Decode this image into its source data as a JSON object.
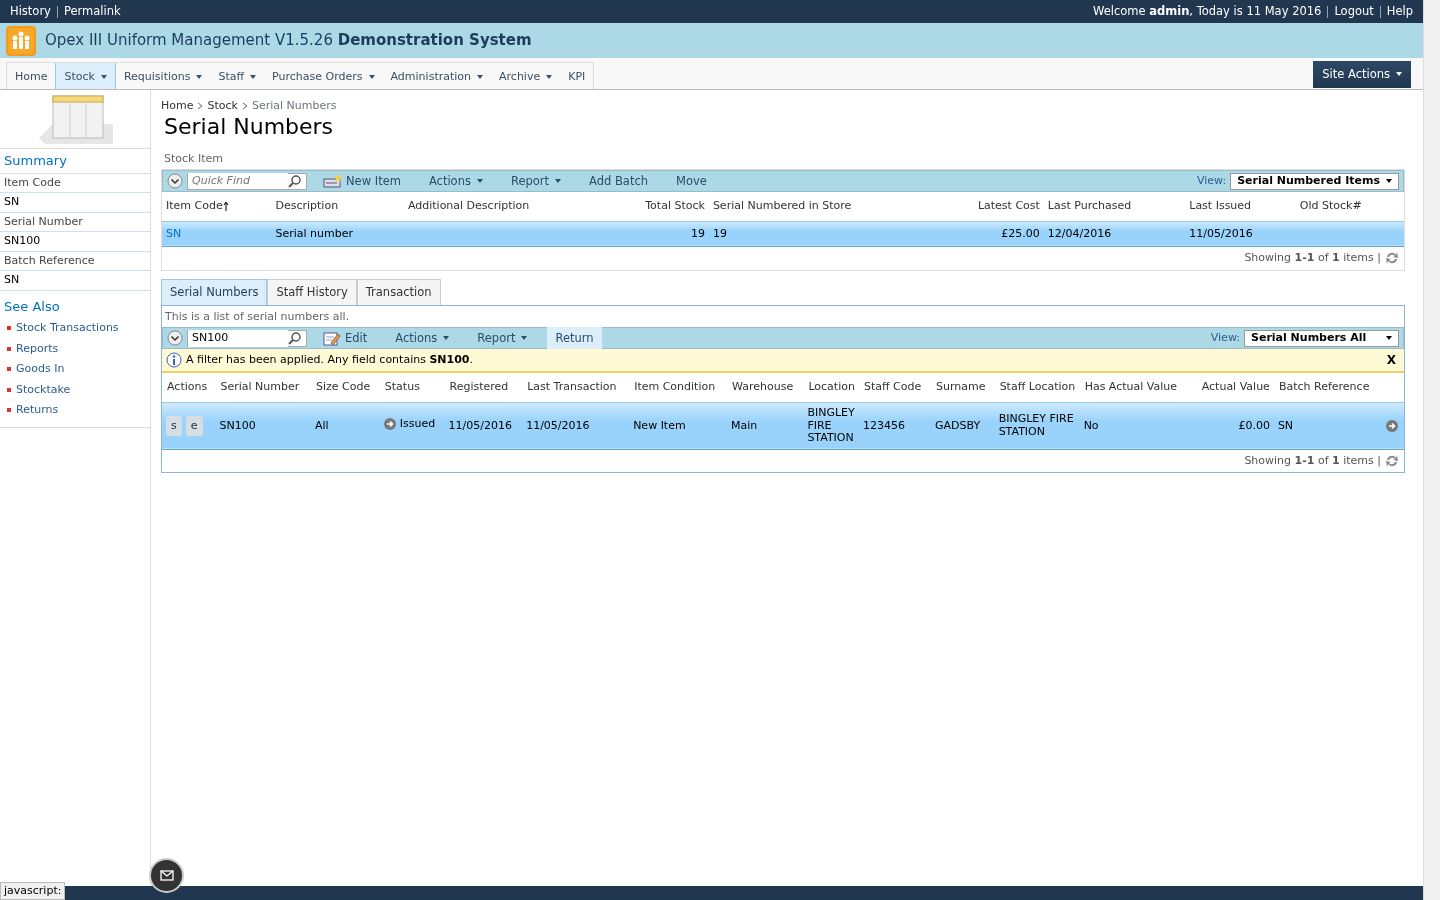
{
  "top_bar": {
    "links": [
      "History",
      "Permalink"
    ],
    "welcome": "Welcome **admin**, Today is 11 May 2016",
    "right_links": [
      "Logout",
      "Help"
    ]
  },
  "header": {
    "title": "Opex III Uniform Management V1.5.26 **Demonstration System**"
  },
  "nav": {
    "items": [
      {
        "label": "Home",
        "has_menu": false,
        "selected": false
      },
      {
        "label": "Stock",
        "has_menu": true,
        "selected": true
      },
      {
        "label": "Requisitions",
        "has_menu": true,
        "selected": false
      },
      {
        "label": "Staff",
        "has_menu": true,
        "selected": false
      },
      {
        "label": "Purchase Orders",
        "has_menu": true,
        "selected": false
      },
      {
        "label": "Administration",
        "has_menu": true,
        "selected": false
      },
      {
        "label": "Archive",
        "has_menu": true,
        "selected": false
      },
      {
        "label": "KPI",
        "has_menu": false,
        "selected": false
      }
    ],
    "site_actions": "Site Actions"
  },
  "sidebar": {
    "summary_title": "Summary",
    "fields": [
      {
        "label": "Item Code",
        "value": "SN"
      },
      {
        "label": "Serial Number",
        "value": "SN100"
      },
      {
        "label": "Batch Reference",
        "value": "SN"
      }
    ],
    "see_also_title": "See Also",
    "links": [
      "Stock Transactions",
      "Reports",
      "Goods In",
      "Stocktake",
      "Returns"
    ]
  },
  "breadcrumb": {
    "links": [
      "Home",
      "Stock"
    ],
    "current": "Serial Numbers"
  },
  "page_title": "Serial Numbers",
  "stock_section": {
    "label": "Stock Item",
    "toolbar": {
      "search_placeholder": "Quick Find",
      "buttons": [
        {
          "label": "New Item",
          "kind": "new"
        },
        {
          "label": "Actions",
          "kind": "menu"
        },
        {
          "label": "Report",
          "kind": "menu"
        },
        {
          "label": "Add Batch",
          "kind": "plain"
        },
        {
          "label": "Move",
          "kind": "plain"
        }
      ],
      "view_label": "View:",
      "view": "Serial Numbered Items"
    },
    "columns": [
      {
        "label": "Item Code",
        "kind": "link",
        "sorted": true
      },
      {
        "label": "Description",
        "kind": "text",
        "sorted": false
      },
      {
        "label": "Additional Description",
        "kind": "text",
        "sorted": false
      },
      {
        "label": "Total Stock",
        "kind": "number",
        "sorted": false
      },
      {
        "label": "Serial Numbered in Store",
        "kind": "text",
        "sorted": false
      },
      {
        "label": "Latest Cost",
        "kind": "number",
        "sorted": false
      },
      {
        "label": "Last Purchased",
        "kind": "text",
        "sorted": false
      },
      {
        "label": "Last Issued",
        "kind": "text",
        "sorted": false
      },
      {
        "label": "Old Stock#",
        "kind": "text",
        "sorted": false
      }
    ],
    "rows": [
      {
        "selected": true,
        "cells": [
          "SN",
          "Serial number",
          "",
          "19",
          "19",
          "£25.00",
          "12/04/2016",
          "11/05/2016",
          ""
        ]
      }
    ],
    "footer": "Showing **1-1** of **1** items |"
  },
  "tabs": [
    {
      "label": "Serial Numbers",
      "selected": true
    },
    {
      "label": "Staff History",
      "selected": false
    },
    {
      "label": "Transaction",
      "selected": false
    }
  ],
  "serial_section": {
    "description": "This is a list of serial numbers all.",
    "toolbar": {
      "search_value": "SN100",
      "buttons": [
        {
          "label": "Edit",
          "kind": "edit",
          "selected": false
        },
        {
          "label": "Actions",
          "kind": "menu",
          "selected": false
        },
        {
          "label": "Report",
          "kind": "menu",
          "selected": false
        },
        {
          "label": "Return",
          "kind": "plain",
          "selected": true
        }
      ],
      "view_label": "View:",
      "view": "Serial Numbers All"
    },
    "filter_message": "A filter has been applied. Any field contains **SN100**.",
    "filter_close": "X",
    "columns": [
      {
        "label": "Actions",
        "kind": "actions"
      },
      {
        "label": "Serial Number",
        "kind": "text"
      },
      {
        "label": "Size Code",
        "kind": "text"
      },
      {
        "label": "Status",
        "kind": "status"
      },
      {
        "label": "Registered",
        "kind": "text"
      },
      {
        "label": "Last Transaction",
        "kind": "text"
      },
      {
        "label": "Item Condition",
        "kind": "text"
      },
      {
        "label": "Warehouse",
        "kind": "text"
      },
      {
        "label": "Location",
        "kind": "wrap"
      },
      {
        "label": "Staff Code",
        "kind": "text"
      },
      {
        "label": "Surname",
        "kind": "text"
      },
      {
        "label": "Staff Location",
        "kind": "wrap"
      },
      {
        "label": "Has Actual Value",
        "kind": "text"
      },
      {
        "label": "Actual Value",
        "kind": "number"
      },
      {
        "label": "Batch Reference",
        "kind": "text"
      }
    ],
    "rows": [
      {
        "selected": true,
        "cells": [
          [
            "s",
            "e"
          ],
          "SN100",
          "All",
          "Issued",
          "11/05/2016",
          "11/05/2016",
          "New Item",
          "Main",
          "BINGLEY FIRE STATION",
          "123456",
          "GADSBY",
          "BINGLEY FIRE STATION",
          "No",
          "£0.00",
          "SN"
        ]
      }
    ],
    "footer": "Showing **1-1** of **1** items |"
  },
  "status_bar": {
    "text": "javascript:"
  }
}
